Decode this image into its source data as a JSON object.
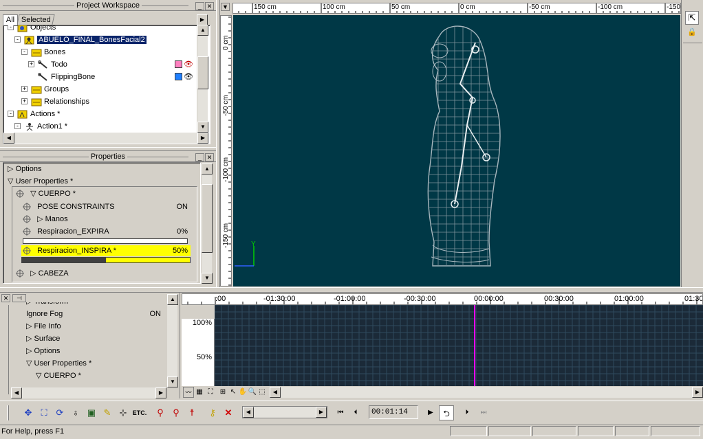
{
  "colors": {
    "viewport_bg": "#003846",
    "timeline_bg": "#1b2a38",
    "selection": "#0a246a",
    "highlight": "#ffff00",
    "accent_line": "#ff00ff",
    "grid_green": "#00d000"
  },
  "workspace": {
    "title": "Project Workspace",
    "tabs": [
      "All",
      "Selected"
    ],
    "tree": [
      {
        "label": "Objects",
        "indent": 0,
        "expander": "-",
        "icon": "objects-icon"
      },
      {
        "label": "ABUELO_FINAL_BonesFacial2",
        "indent": 1,
        "expander": "-",
        "icon": "model-icon",
        "selected": true
      },
      {
        "label": "Bones",
        "indent": 2,
        "expander": "-",
        "icon": "folder-icon"
      },
      {
        "label": "Todo",
        "indent": 3,
        "expander": "+",
        "icon": "bone-icon"
      },
      {
        "label": "FlippingBone",
        "indent": 3,
        "expander": "",
        "icon": "bone-icon"
      },
      {
        "label": "Groups",
        "indent": 2,
        "expander": "+",
        "icon": "folder-icon"
      },
      {
        "label": "Relationships",
        "indent": 2,
        "expander": "+",
        "icon": "folder-icon"
      },
      {
        "label": "Actions *",
        "indent": 0,
        "expander": "-",
        "icon": "actions-icon"
      },
      {
        "label": "Action1 *",
        "indent": 1,
        "expander": "-",
        "icon": "action-icon"
      }
    ]
  },
  "properties": {
    "title": "Properties",
    "rows": {
      "options": "Options",
      "user_properties": "User Properties *",
      "cuerpo": "CUERPO *",
      "pose": "POSE CONSTRAINTS",
      "pose_val": "ON",
      "manos": "Manos",
      "expira": "Respiracion_EXPIRA",
      "expira_val": "0%",
      "expira_level": 0,
      "inspira": "Respiracion_INSPIRA *",
      "inspira_val": "50%",
      "inspira_level": 0.5,
      "cabeza": "CABEZA"
    }
  },
  "ruler": {
    "top": [
      "150 cm",
      "100 cm",
      "50 cm",
      "0 cm",
      "-50 cm",
      "-100 cm",
      "-150"
    ],
    "left": [
      "0 cm",
      "-50 cm",
      "-100 cm",
      "-150 cm"
    ]
  },
  "axes": {
    "y": "Y"
  },
  "timeline_props": {
    "rows": [
      "Transform",
      "Ignore Fog",
      "File Info",
      "Surface",
      "Options",
      "User Properties *",
      "CUERPO *"
    ],
    "ignore_fog_val": "ON"
  },
  "timeline": {
    "ticks": [
      ":00",
      "-01:30:00",
      "-01:00:00",
      "-00:30:00",
      "00:00:00",
      "00:30:00",
      "01:00:00",
      "01:30"
    ],
    "y_labels": [
      "100%",
      "50%"
    ]
  },
  "transport": {
    "time": "00:01:14",
    "etc_label": "ETC."
  },
  "status": {
    "text": "For Help, press F1"
  }
}
